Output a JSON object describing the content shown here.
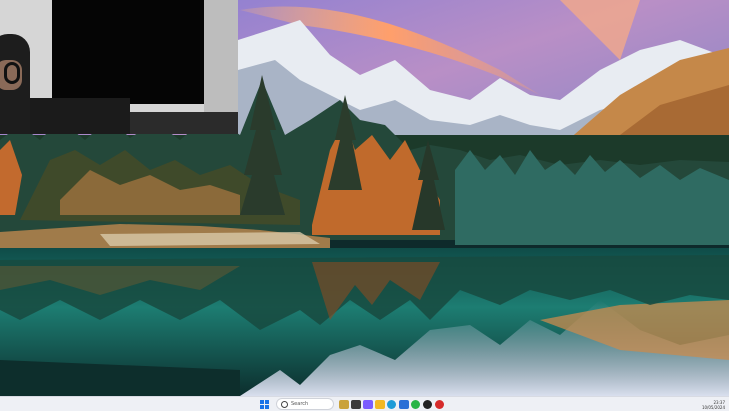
{
  "taskbar": {
    "search_placeholder": "Search",
    "clock_time": "23:37",
    "clock_date": "10/05/2024",
    "apps": [
      {
        "name": "widgets-icon",
        "color": "#caa23b"
      },
      {
        "name": "task-view-icon",
        "color": "#3b3b3b"
      },
      {
        "name": "copilot-icon",
        "color": "#7b5cff"
      },
      {
        "name": "file-explorer-icon",
        "color": "#f2b824"
      },
      {
        "name": "edge-browser-icon",
        "color": "#1e9bd7"
      },
      {
        "name": "store-icon",
        "color": "#2a6fd6"
      },
      {
        "name": "whatsapp-icon",
        "color": "#28b446"
      },
      {
        "name": "media-player-icon",
        "color": "#222222"
      },
      {
        "name": "recorder-icon",
        "color": "#d62b2b"
      }
    ]
  }
}
